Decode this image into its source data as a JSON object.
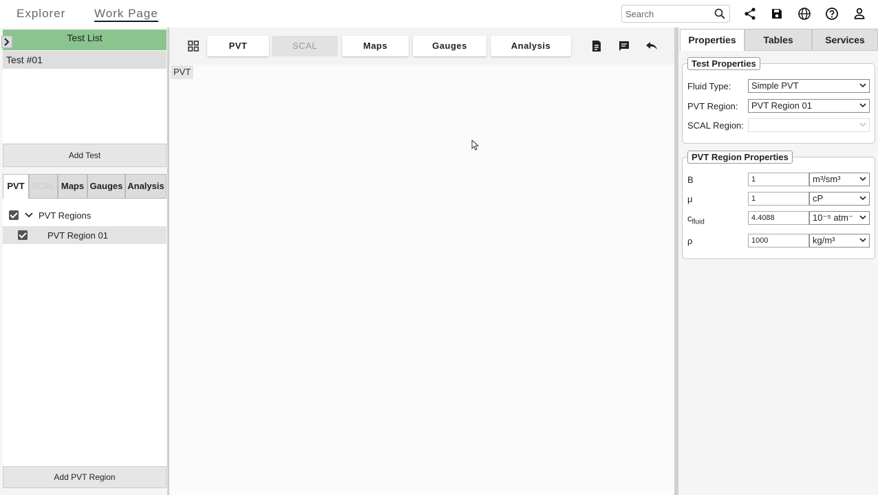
{
  "topbar": {
    "tabs": [
      "Explorer",
      "Work Page"
    ],
    "search_placeholder": "Search"
  },
  "left": {
    "header": "Test List",
    "tests": [
      "Test #01"
    ],
    "add_test": "Add Test",
    "tabs": [
      "PVT",
      "SCAL",
      "Maps",
      "Gauges",
      "Analysis"
    ],
    "tree": {
      "group": "PVT Regions",
      "items": [
        "PVT Region 01"
      ]
    },
    "add_region": "Add PVT Region"
  },
  "center": {
    "tabs": [
      "PVT",
      "SCAL",
      "Maps",
      "Gauges",
      "Analysis"
    ],
    "chip": "PVT"
  },
  "right": {
    "tabs": [
      "Properties",
      "Tables",
      "Services"
    ],
    "test_props": {
      "title": "Test Properties",
      "fluid_type_label": "Fluid Type:",
      "fluid_type_value": "Simple PVT",
      "pvt_region_label": "PVT Region:",
      "pvt_region_value": "PVT Region 01",
      "scal_region_label": "SCAL Region:",
      "scal_region_value": ""
    },
    "region_props": {
      "title": "PVT Region Properties",
      "rows": [
        {
          "label": "B",
          "sub": "",
          "value": "1",
          "unit": "m³/sm³"
        },
        {
          "label": "μ",
          "sub": "",
          "value": "1",
          "unit": "cP"
        },
        {
          "label": "c",
          "sub": "fluid",
          "value": "4.4088",
          "unit": "10⁻⁵ atm⁻"
        },
        {
          "label": "ρ",
          "sub": "",
          "value": "1000",
          "unit": "kg/m³"
        }
      ]
    }
  },
  "colors": {
    "header_green": "#8bc48f"
  }
}
